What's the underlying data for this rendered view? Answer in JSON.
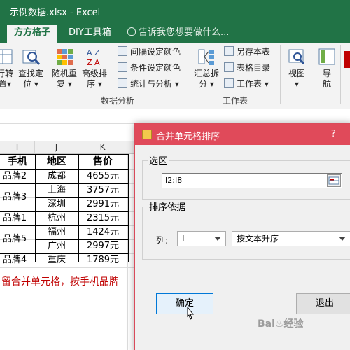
{
  "window": {
    "title": "示例数据.xlsx - Excel"
  },
  "tabs": {
    "active": "方方格子",
    "diy": "DIY工具箱",
    "tell_me": "告诉我您想要做什么..."
  },
  "ribbon": {
    "btn_row_col": [
      "行转",
      "置▾"
    ],
    "btn_find_locate": [
      "查找定",
      "位 ▾"
    ],
    "btn_random_repeat": [
      "随机重",
      "复 ▾"
    ],
    "btn_advanced_sort": [
      "高级排",
      "序 ▾"
    ],
    "small_interval_color": "间隔设定颜色",
    "small_cond_color": "条件设定颜色",
    "small_stats": "统计与分析 ▾",
    "group_data_analysis": "数据分析",
    "btn_summary_split": [
      "汇总拆",
      "分 ▾"
    ],
    "small_save_table": "另存本表",
    "small_table_dir": "表格目录",
    "small_worksheet": "工作表 ▾",
    "group_worksheet": "工作表",
    "btn_view": [
      "视图",
      "▾"
    ],
    "btn_nav": [
      "导",
      "航"
    ]
  },
  "sheet": {
    "col_headers": [
      "I",
      "J",
      "K"
    ],
    "table_headers": [
      "手机",
      "地区",
      "售价"
    ],
    "phone_cells": [
      "品牌2",
      "品牌3",
      "品牌1",
      "品牌5",
      "品牌4"
    ],
    "region_cells": [
      "成都",
      "上海",
      "深圳",
      "杭州",
      "福州",
      "广州",
      "重庆"
    ],
    "price_cells": [
      "4655元",
      "3757元",
      "2991元",
      "2315元",
      "1424元",
      "2997元",
      "1789元"
    ],
    "note": "留合并单元格，按手机品牌"
  },
  "dialog": {
    "title": "合并单元格排序",
    "help": "?",
    "range_legend": "选区",
    "range_value": "I2:I8",
    "sort_legend": "排序依据",
    "column_label": "列:",
    "column_value": "I",
    "order_value": "按文本升序",
    "ok_label": "确定",
    "exit_label": "退出"
  },
  "watermark": "Bai♨经验"
}
